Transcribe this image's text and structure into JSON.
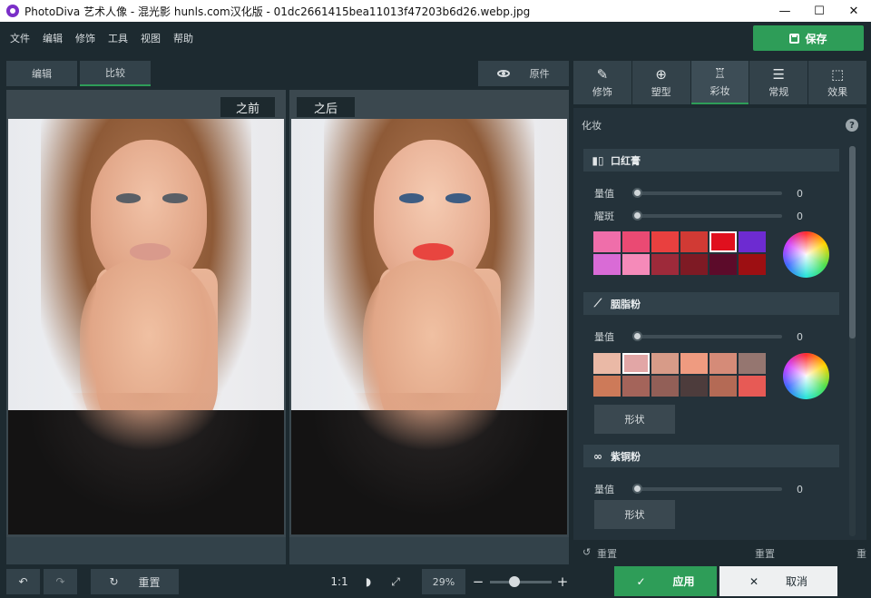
{
  "window": {
    "title": "PhotoDiva 艺术人像 - 混光影 hunls.com汉化版 - 01dc2661415bea11013f47203b6d26.webp.jpg",
    "controls": [
      "—",
      "☐",
      "✕"
    ]
  },
  "menu": [
    "文件",
    "编辑",
    "修饰",
    "工具",
    "视图",
    "帮助"
  ],
  "save_label": "保存",
  "view_tabs": {
    "edit": "编辑",
    "compare": "比较",
    "active": "compare"
  },
  "original_label": "原件",
  "compare": {
    "before": "之前",
    "after": "之后"
  },
  "colors": {
    "accent": "#2e9d58",
    "lips_before": "#d99a8c",
    "lips_after": "#e8453f"
  },
  "panel_tabs": [
    {
      "label": "修饰",
      "icon": "retouch-icon"
    },
    {
      "label": "塑型",
      "icon": "reshape-icon"
    },
    {
      "label": "彩妆",
      "icon": "makeup-icon",
      "active": true
    },
    {
      "label": "常规",
      "icon": "sliders-icon"
    },
    {
      "label": "效果",
      "icon": "effects-icon"
    }
  ],
  "panel": {
    "heading": "化妆",
    "help": "?",
    "lipstick": {
      "title": "口红膏",
      "sliders": [
        {
          "label": "量值",
          "value": "0"
        },
        {
          "label": "耀斑",
          "value": "0"
        }
      ],
      "swatches": [
        "#ef6eaa",
        "#ea4a73",
        "#e9403f",
        "#d13a34",
        "#e0101e",
        "#6d2bd1",
        "#d96bd6",
        "#f58ab9",
        "#9e2a3a",
        "#7e1a24",
        "#5c0b2a",
        "#9d0f12"
      ],
      "selected_swatch": 4
    },
    "blush": {
      "title": "胭脂粉",
      "sliders": [
        {
          "label": "量值",
          "value": "0"
        }
      ],
      "swatches": [
        "#eab9a6",
        "#e2a6a6",
        "#d79b88",
        "#ef9b80",
        "#d58b78",
        "#957670",
        "#cd7a59",
        "#a4645a",
        "#925f57",
        "#4d3c3c",
        "#b46a55",
        "#e75a55"
      ],
      "selected_swatch": 1,
      "shape_label": "形状"
    },
    "bronzer": {
      "title": "紫铜粉",
      "sliders": [
        {
          "label": "量值",
          "value": "0"
        }
      ],
      "shape_label": "形状"
    },
    "footer": [
      "重置",
      "重置",
      "重"
    ]
  },
  "bottom": {
    "reset_label": "重置",
    "ratio_label": "1:1",
    "zoom": "29%",
    "zoom_slider_percent": 40,
    "apply_label": "应用",
    "cancel_label": "取消"
  }
}
